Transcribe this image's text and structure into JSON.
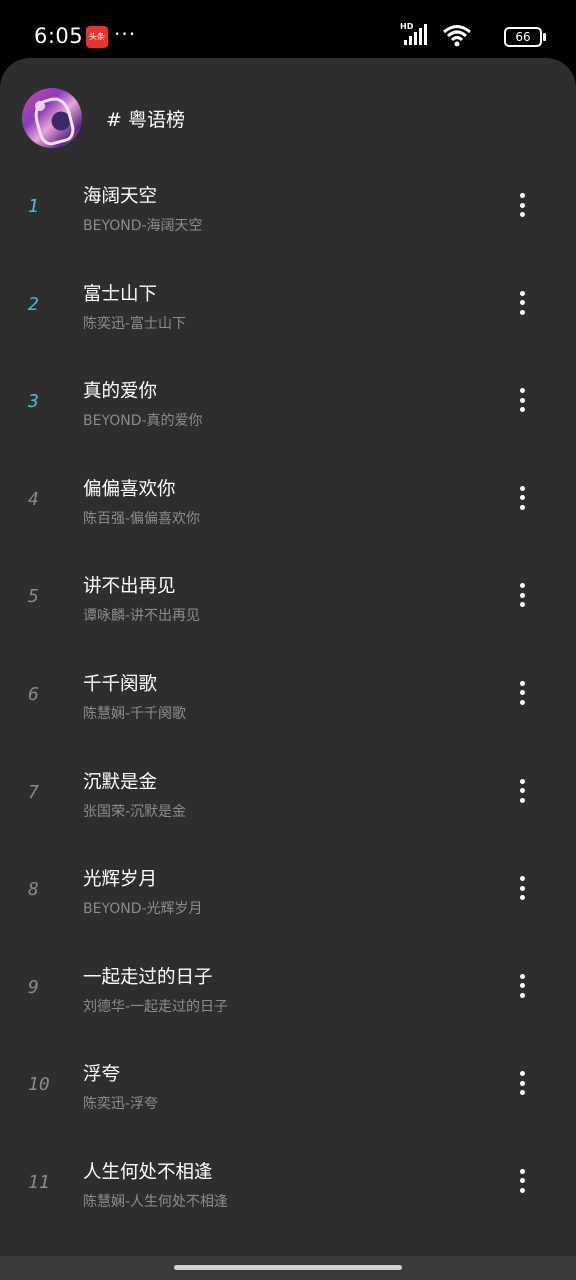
{
  "status_bar": {
    "time": "6:05",
    "app_badge": "头条",
    "more": "···",
    "hd": "HD",
    "battery": "66"
  },
  "header": {
    "title": "# 粤语榜"
  },
  "colors": {
    "top_rank": "#3fc3d0",
    "normal_rank": "#8a8a8a",
    "background": "#2e2e2e"
  },
  "songs": [
    {
      "rank": "1",
      "title": "海阔天空",
      "subtitle": "BEYOND-海阔天空"
    },
    {
      "rank": "2",
      "title": "富士山下",
      "subtitle": "陈奕迅-富士山下"
    },
    {
      "rank": "3",
      "title": "真的爱你",
      "subtitle": "BEYOND-真的爱你"
    },
    {
      "rank": "4",
      "title": "偏偏喜欢你",
      "subtitle": "陈百强-偏偏喜欢你"
    },
    {
      "rank": "5",
      "title": "讲不出再见",
      "subtitle": "谭咏麟-讲不出再见"
    },
    {
      "rank": "6",
      "title": "千千阕歌",
      "subtitle": "陈慧娴-千千阕歌"
    },
    {
      "rank": "7",
      "title": "沉默是金",
      "subtitle": "张国荣-沉默是金"
    },
    {
      "rank": "8",
      "title": "光辉岁月",
      "subtitle": "BEYOND-光辉岁月"
    },
    {
      "rank": "9",
      "title": "一起走过的日子",
      "subtitle": "刘德华-一起走过的日子"
    },
    {
      "rank": "10",
      "title": "浮夸",
      "subtitle": "陈奕迅-浮夸"
    },
    {
      "rank": "11",
      "title": "人生何处不相逢",
      "subtitle": "陈慧娴-人生何处不相逢"
    }
  ]
}
